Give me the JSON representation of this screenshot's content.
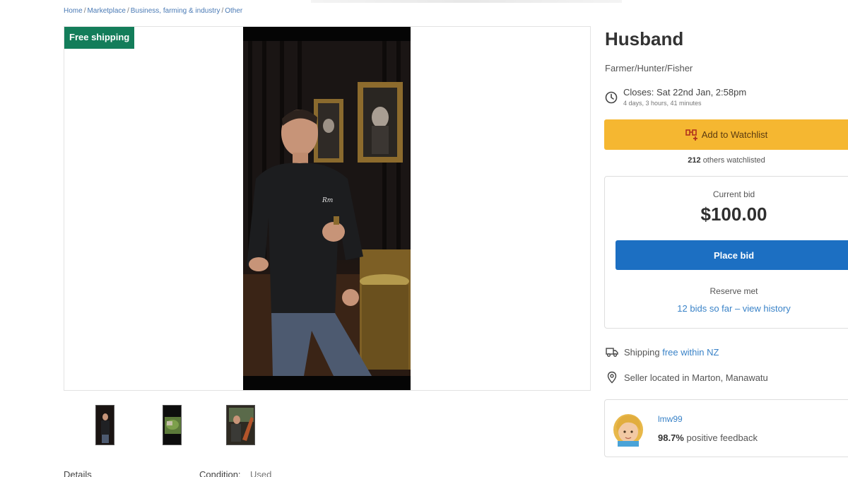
{
  "breadcrumb": [
    "Home",
    "Marketplace",
    "Business, farming & industry",
    "Other"
  ],
  "gallery": {
    "badge": "Free shipping",
    "thumbnails": [
      "Photo 1",
      "Photo 2",
      "Photo 3"
    ]
  },
  "details": {
    "heading": "Details",
    "condition_label": "Condition:",
    "condition_value": "Used"
  },
  "listing": {
    "title": "Husband",
    "subtitle": "Farmer/Hunter/Fisher",
    "closes_text": "Closes: Sat 22nd Jan, 2:58pm",
    "closes_remaining": "4 days, 3 hours, 41 minutes"
  },
  "watchlist": {
    "button_label": "Add to Watchlist",
    "count": "212",
    "count_suffix": "others watchlisted"
  },
  "bid": {
    "label": "Current bid",
    "amount": "$100.00",
    "button_label": "Place bid",
    "reserve": "Reserve met",
    "history_link": "12 bids so far – view history"
  },
  "shipping": {
    "label": "Shipping",
    "value": "free within NZ"
  },
  "location": {
    "text": "Seller located in Marton, Manawatu"
  },
  "seller": {
    "username": "lmw99",
    "feedback_percent": "98.7%",
    "feedback_suffix": "positive feedback"
  },
  "colors": {
    "badge": "#137d5a",
    "watch_button": "#f5b731",
    "bid_button": "#1c6fc2",
    "link": "#3a83c8"
  },
  "icons": [
    "clock-icon",
    "watchlist-icon",
    "truck-icon",
    "location-pin-icon",
    "avatar"
  ]
}
